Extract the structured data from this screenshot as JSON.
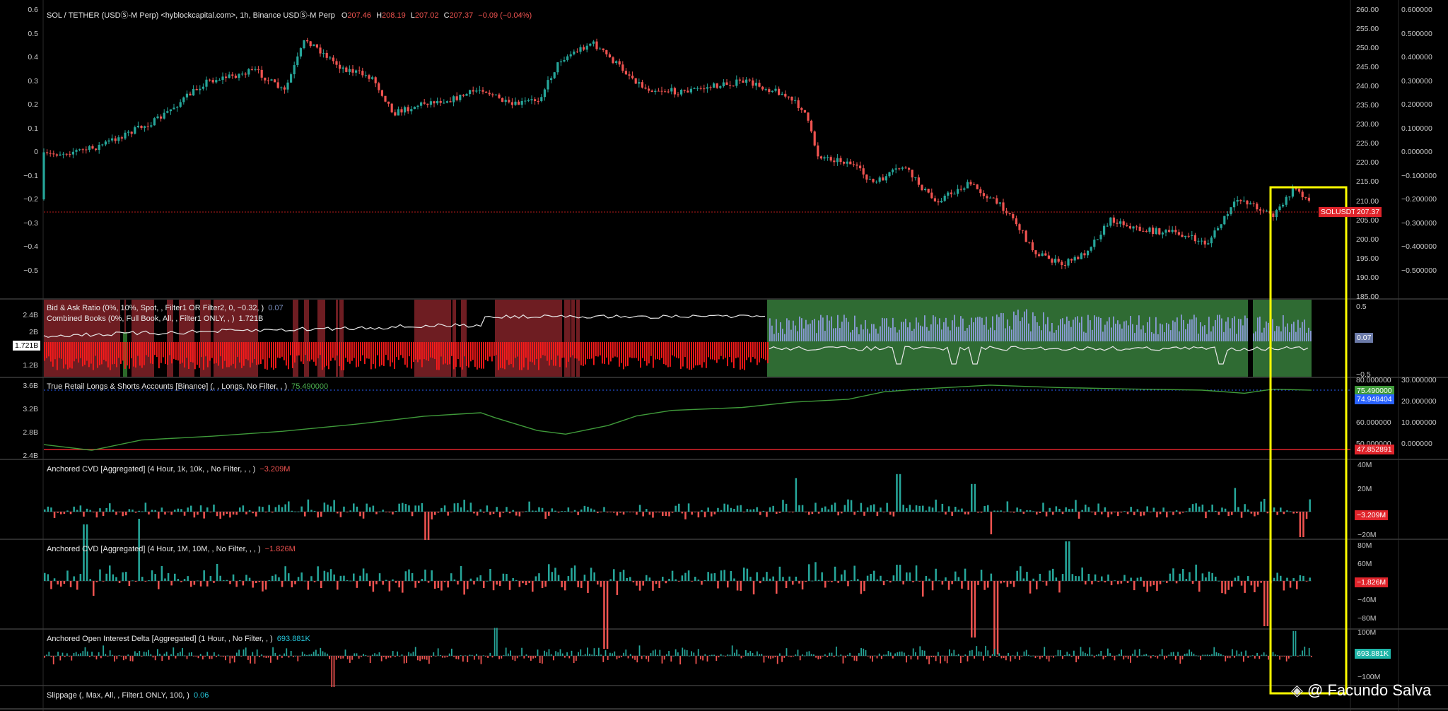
{
  "main": {
    "title": "SOL / TETHER (USDⓈ-M Perp) <hyblockcapital.com>, 1h, Binance USDⓈ-M Perp",
    "ohlc": [
      {
        "k": "O",
        "v": "207.46"
      },
      {
        "k": "H",
        "v": "208.19"
      },
      {
        "k": "L",
        "v": "207.02"
      },
      {
        "k": "C",
        "v": "207.37"
      }
    ],
    "change": "−0.09 (−0.04%)",
    "price_axis": [
      "260.00",
      "255.00",
      "250.00",
      "245.00",
      "240.00",
      "235.00",
      "230.00",
      "225.00",
      "220.00",
      "215.00",
      "210.00",
      "205.00",
      "200.00",
      "195.00",
      "190.00",
      "185.00"
    ],
    "left_axis": [
      "0.6",
      "0.5",
      "0.4",
      "0.3",
      "0.2",
      "0.1",
      "0",
      "−0.1",
      "−0.2",
      "−0.3",
      "−0.4",
      "−0.5"
    ],
    "far_axis": [
      "0.600000",
      "0.500000",
      "0.400000",
      "0.300000",
      "0.200000",
      "0.100000",
      "0.000000",
      "−0.100000",
      "−0.200000",
      "−0.300000",
      "−0.400000",
      "−0.500000"
    ],
    "symbol_tag": "SOLUSDT",
    "price_tag": "207.37"
  },
  "bidask": {
    "title": "Bid & Ask Ratio (0%, 10%, Spot, , Filter1 OR Filter2, 0, −0.32, )",
    "value": "0.07",
    "title2": "Combined Books (0%, Full Book, All, , Filter1 ONLY, , )",
    "value2": "1.721B",
    "left_axis": [
      "2.4B",
      "2B",
      "1.2B"
    ],
    "left_tag": "1.721B",
    "right_axis": [
      "0.5",
      "−0.5"
    ],
    "right_tag": "0.07"
  },
  "retail": {
    "title": "True Retail Longs & Shorts Accounts [Binance] (, , Longs, No Filter, , )",
    "value": "75.490000",
    "left_axis": [
      "3.6B",
      "3.2B",
      "2.8B",
      "2.4B"
    ],
    "right_axis": [
      "80.000000",
      "60.000000",
      "50.000000"
    ],
    "far_axis": [
      "30.000000",
      "20.000000",
      "10.000000",
      "0.000000"
    ],
    "tag1": "75.490000",
    "tag2": "74.948404",
    "tag3": "47.852891"
  },
  "cvd1": {
    "title": "Anchored CVD [Aggregated] (4 Hour, 1k, 10k, , No Filter, , , )",
    "value": "−3.209M",
    "right_axis": [
      "40M",
      "20M",
      "−20M"
    ],
    "tag": "−3.209M"
  },
  "cvd2": {
    "title": "Anchored CVD [Aggregated] (4 Hour, 1M, 10M, , No Filter, , , )",
    "value": "−1.826M",
    "right_axis": [
      "80M",
      "60M",
      "40M",
      "−40M",
      "−80M"
    ],
    "tag": "−1.826M"
  },
  "oi": {
    "title": "Anchored Open Interest Delta [Aggregated] (1 Hour, , No Filter, , )",
    "value": "693.881K",
    "right_axis": [
      "100M",
      "−100M"
    ],
    "tag": "693.881K"
  },
  "slippage": {
    "title": "Slippage (, Max, All, , Filter1 ONLY, 100, )",
    "value": "0.06"
  },
  "watermark": "@ Facundo Salva",
  "colors": {
    "up": "#26a69a",
    "down": "#ef5350",
    "highlight": "#ffff00",
    "green_zone": "#2f6b33",
    "red_zone": "#6e1d22",
    "retail_line": "#3f9a3a"
  }
}
